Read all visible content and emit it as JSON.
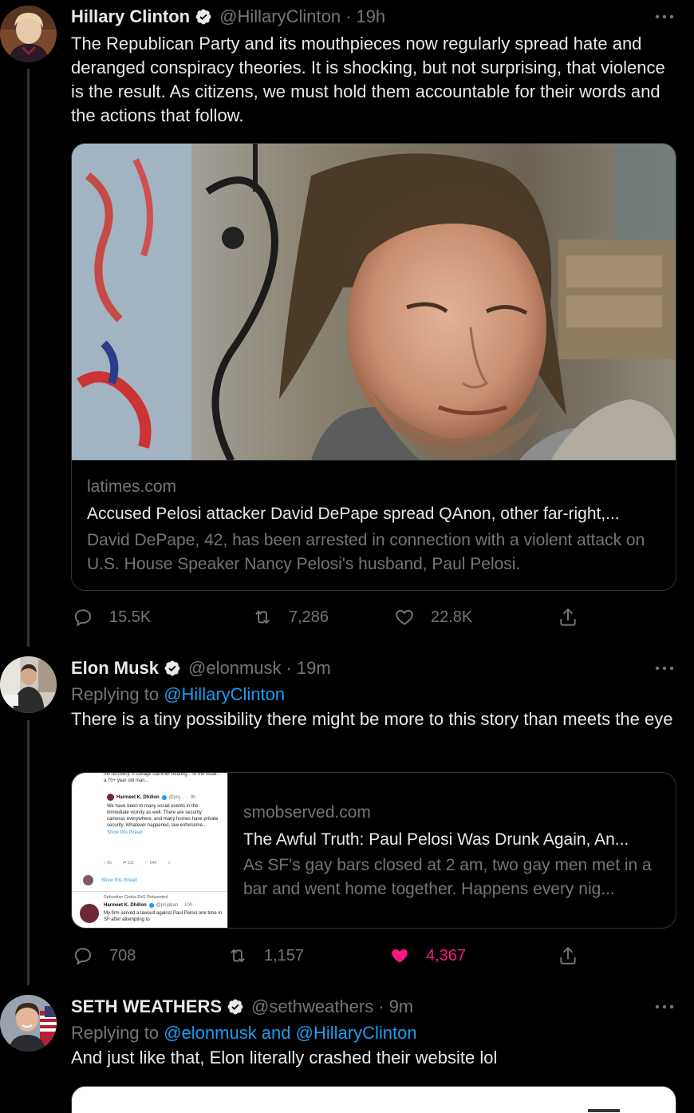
{
  "tweets": [
    {
      "name": "Hillary Clinton",
      "handle": "@HillaryClinton",
      "time": "19h",
      "text": "The Republican Party and its mouthpieces now regularly spread hate and deranged conspiracy theories. It is shocking, but not surprising, that violence is the result. As citizens, we must hold them accountable for their words and the actions that follow.",
      "card": {
        "domain": "latimes.com",
        "title": "Accused Pelosi attacker David DePape spread QAnon, other far-right,...",
        "description": "David DePape, 42, has been arrested in connection with a violent attack on U.S. House Speaker Nancy Pelosi's husband, Paul Pelosi."
      },
      "replies": "15.5K",
      "retweets": "7,286",
      "likes": "22.8K"
    },
    {
      "name": "Elon Musk",
      "handle": "@elonmusk",
      "time": "19m",
      "replying_prefix": "Replying to",
      "replying_to": "@HillaryClinton",
      "text": "There is a tiny possibility there might be more to this story than meets the eye",
      "card": {
        "domain": "smobserved.com",
        "title": "The Awful Truth: Paul Pelosi Was Drunk Again, An...",
        "description": "As SF's gay bars closed at 2 am, two gay men met in a bar and went home together. Happens every nig...",
        "thumb": {
          "top_text": "full recovery. A savage hammer beating... to the head... a 70+ year old man...",
          "quote_name": "Harmeet K. Dhillon",
          "quote_handle": "@pnj...",
          "quote_time": "9h",
          "quote_text": "We have been to many social events in the immediate vicinity as well. There are security cameras everywhere, and many homes have private security. Whatever happened, law enforceme...",
          "show_thread_1": "Show this thread",
          "stat_reply": "65",
          "stat_rt": "131",
          "stat_like": "640",
          "show_thread_2": "Show this thread",
          "retweeted_by": "Sebastian Gorka DrG Retweeted",
          "quote2_name": "Harmeet K. Dhillon",
          "quote2_handle": "@pnjaban",
          "quote2_time": "10h",
          "quote2_text": "My firm served a lawsuit against Paul Pelosi one time in SF after attempting to"
        }
      },
      "replies": "708",
      "retweets": "1,157",
      "likes": "4,367"
    },
    {
      "name": "SETH WEATHERS",
      "handle": "@sethweathers",
      "time": "9m",
      "replying_prefix": "Replying to",
      "replying_to": "@elonmusk and @HillaryClinton",
      "text": "And just like that, Elon literally crashed their website lol"
    }
  ],
  "colors": {
    "background": "#000000",
    "text": "#e7e9ea",
    "muted": "#71767b",
    "link": "#1d9bf0",
    "like": "#f91880",
    "verified": "#e7e9ea"
  }
}
